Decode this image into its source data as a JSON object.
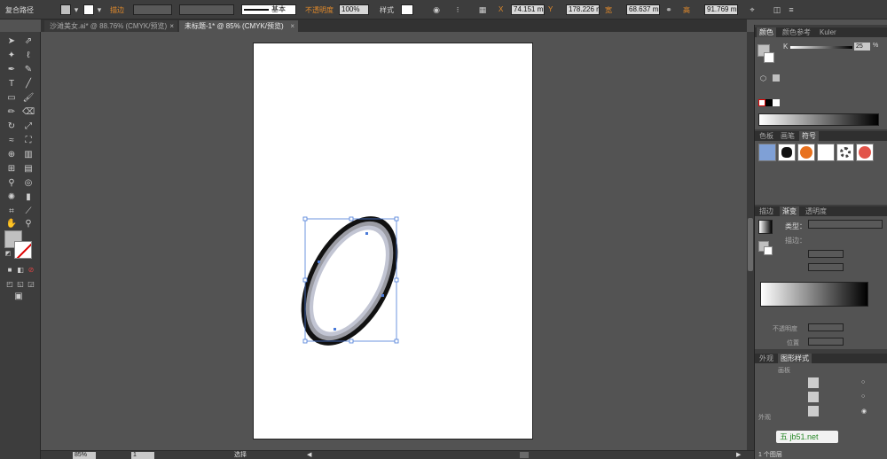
{
  "control_bar": {
    "selection_type": "复合路径",
    "stroke_label": "描边",
    "stroke_style": "基本",
    "opacity_label": "不透明度",
    "opacity_value": "100%",
    "style_label": "样式",
    "x_label": "X",
    "x_value": "74.151 mm",
    "y_label": "Y",
    "y_value": "178.226 mm",
    "w_label": "宽",
    "w_value": "68.637 mm",
    "h_label": "高",
    "h_value": "91.769 mm"
  },
  "tabs": [
    {
      "label": "沙滩美女.ai* @ 88.76% (CMYK/预览)",
      "active": false
    },
    {
      "label": "未标题-1* @ 85% (CMYK/预览)",
      "active": true
    }
  ],
  "status": {
    "zoom": "85%",
    "page": "1",
    "mode": "选择"
  },
  "panels": {
    "color": {
      "tabs": [
        "颜色",
        "颜色参考",
        "Kuler"
      ],
      "channel": "K",
      "value": "25",
      "unit": "%"
    },
    "symbols": {
      "tabs": [
        "色板",
        "画笔",
        "符号"
      ]
    },
    "gradient": {
      "tabs": [
        "描边",
        "渐变",
        "透明度"
      ],
      "type_label": "类型：",
      "stroke_label": "描边：",
      "opacity_label": "不透明度",
      "position_label": "位置"
    },
    "styles": {
      "tabs": [
        "外观",
        "图形样式"
      ],
      "artboard_label": "画板",
      "outer_label": "外观",
      "layers_count": "1 个图层"
    }
  },
  "watermark": "五 jb51.net"
}
